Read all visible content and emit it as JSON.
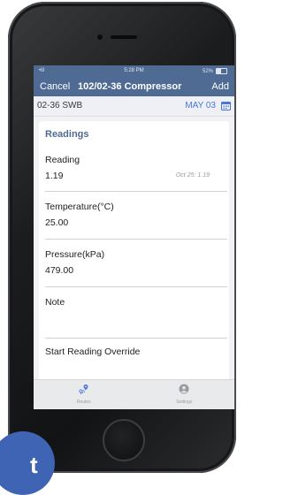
{
  "status_bar": {
    "signal": "•ill",
    "time": "5:28 PM",
    "battery": "52%"
  },
  "nav": {
    "cancel_label": "Cancel",
    "title": "102/02-36 Compressor",
    "add_label": "Add"
  },
  "subheader": {
    "station": "02-36 SWB",
    "date": "MAY 03",
    "calendar_icon": "calendar-icon"
  },
  "card": {
    "title": "Readings",
    "fields": [
      {
        "label": "Reading",
        "value": "1.19",
        "previous": "Oct 25: 1.19"
      },
      {
        "label": "Temperature(°C)",
        "value": "25.00"
      },
      {
        "label": "Pressure(kPa)",
        "value": "479.00"
      },
      {
        "label": "Note",
        "value": ""
      },
      {
        "label": "Start Reading Override",
        "value": ""
      }
    ]
  },
  "tabbar": {
    "tabs": [
      {
        "label": "Routes",
        "icon": "route-pin-icon"
      },
      {
        "label": "Settings",
        "icon": "settings-user-icon"
      }
    ]
  },
  "colors": {
    "header": "#4f6b93",
    "accent": "#4a78d8",
    "badge": "#3f64b4"
  },
  "badge": {
    "text": "t"
  }
}
